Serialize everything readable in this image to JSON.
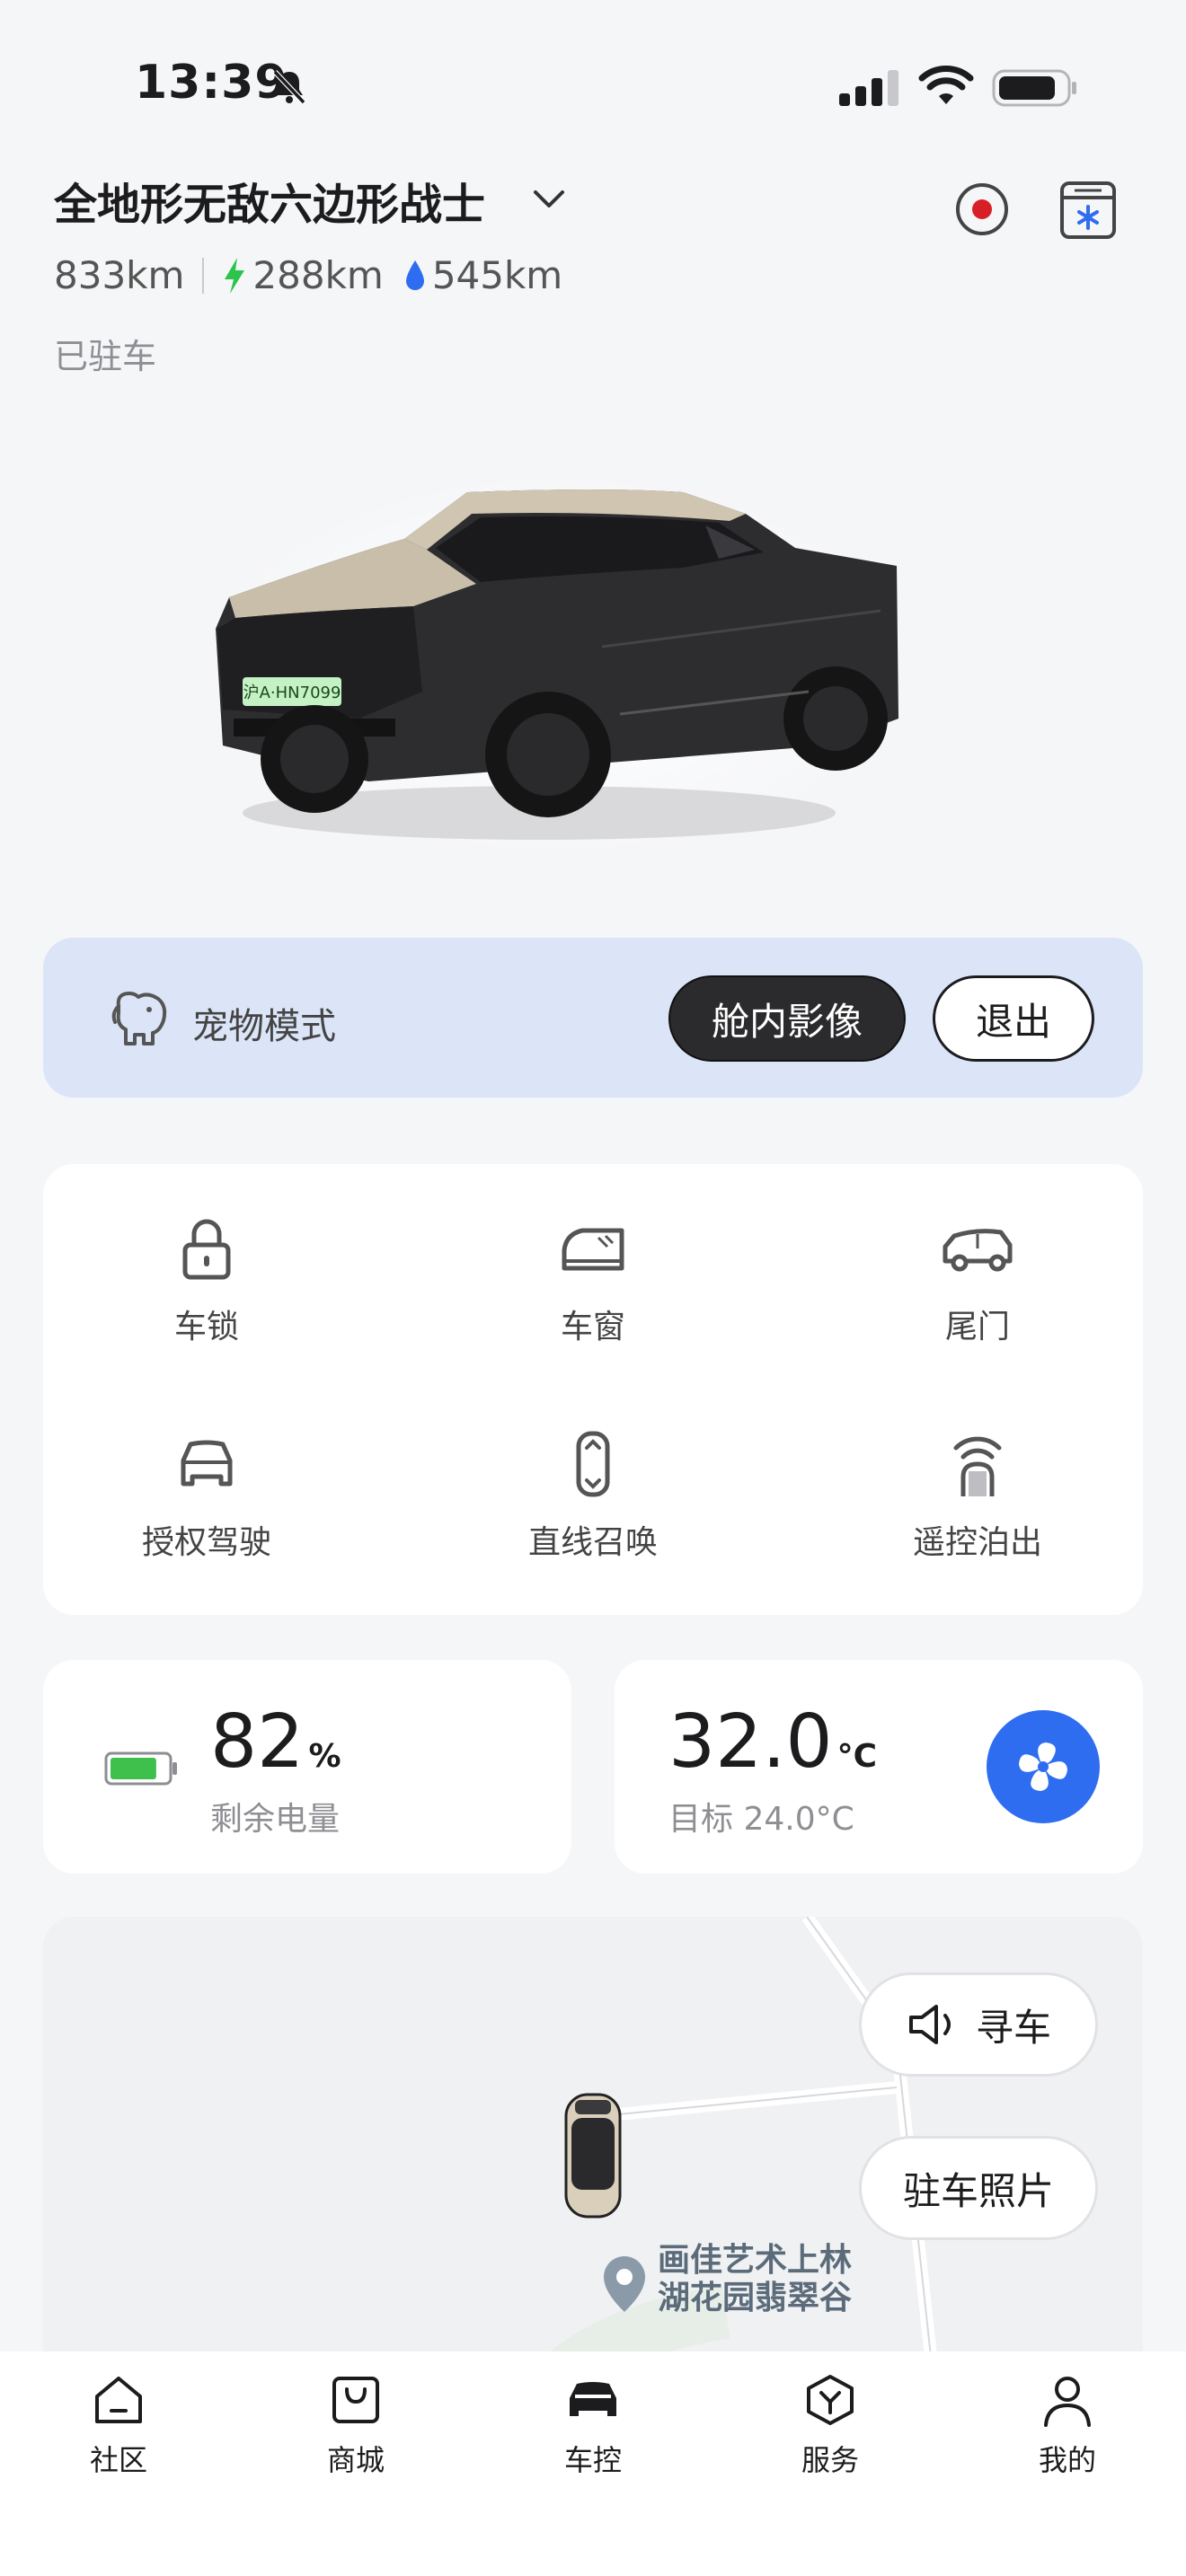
{
  "status_bar": {
    "time": "13:39"
  },
  "vehicle": {
    "name": "全地形无敌六边形战士",
    "total_range": "833km",
    "electric_range": "288km",
    "fuel_range": "545km",
    "state": "已驻车",
    "plate": "沪A·HN7099"
  },
  "pet_mode": {
    "label": "宠物模式",
    "cabin_button": "舱内影像",
    "exit_button": "退出"
  },
  "controls": [
    {
      "label": "车锁",
      "icon": "lock-icon"
    },
    {
      "label": "车窗",
      "icon": "window-icon"
    },
    {
      "label": "尾门",
      "icon": "tailgate-icon"
    },
    {
      "label": "授权驾驶",
      "icon": "authorized-drive-icon"
    },
    {
      "label": "直线召唤",
      "icon": "summon-icon"
    },
    {
      "label": "遥控泊出",
      "icon": "remote-park-icon"
    }
  ],
  "battery": {
    "value": "82",
    "unit": "%",
    "label": "剩余电量",
    "level": 0.82,
    "color": "#3fbf4c"
  },
  "climate": {
    "value": "32.0",
    "unit": "°C",
    "target": "目标 24.0°C",
    "accent": "#2f6df0"
  },
  "map": {
    "find_car": "寻车",
    "parking_photo": "驻车照片",
    "poi": "画佳艺术上林湖花园翡翠谷"
  },
  "tabs": [
    {
      "label": "社区",
      "icon": "home-icon"
    },
    {
      "label": "商城",
      "icon": "shop-bag-icon"
    },
    {
      "label": "车控",
      "icon": "car-control-icon",
      "active": true
    },
    {
      "label": "服务",
      "icon": "service-icon"
    },
    {
      "label": "我的",
      "icon": "profile-icon"
    }
  ]
}
